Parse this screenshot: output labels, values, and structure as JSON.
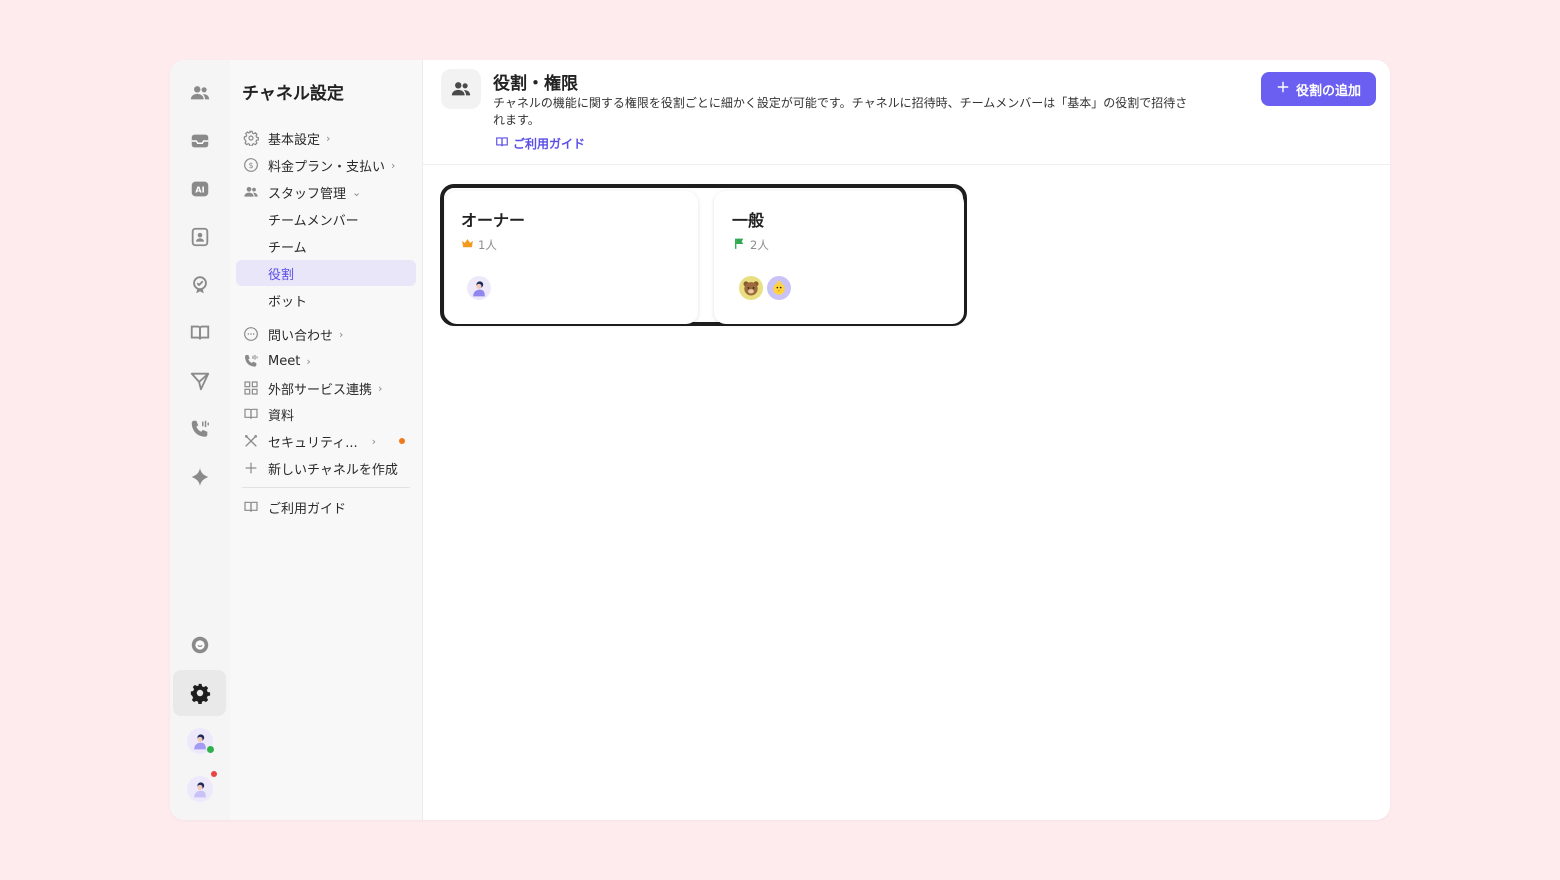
{
  "sidebar": {
    "title": "チャネル設定",
    "items": [
      {
        "label": "基本設定",
        "icon": "gear-icon"
      },
      {
        "label": "料金プラン・支払い",
        "icon": "dollar-icon"
      },
      {
        "label": "スタッフ管理",
        "icon": "people-icon"
      },
      {
        "label": "チームメンバー"
      },
      {
        "label": "チーム"
      },
      {
        "label": "役割"
      },
      {
        "label": "ボット"
      },
      {
        "label": "問い合わせ",
        "icon": "chat-icon"
      },
      {
        "label": "Meet",
        "icon": "phone-icon"
      },
      {
        "label": "外部サービス連携",
        "icon": "grid-icon"
      },
      {
        "label": "資料",
        "icon": "book-icon"
      },
      {
        "label": "セキュリティ...",
        "icon": "tools-icon"
      },
      {
        "label": "新しいチャネルを作成",
        "icon": "plus-icon"
      },
      {
        "label": "ご利用ガイド",
        "icon": "book-icon"
      }
    ]
  },
  "header": {
    "title": "役割・権限",
    "description": "チャネルの機能に関する権限を役割ごとに細かく設定が可能です。チャネルに招待時、チームメンバーは「基本」の役割で招待されます。",
    "guide_label": "ご利用ガイド",
    "add_button_label": "役割の追加"
  },
  "roles": [
    {
      "name": "オーナー",
      "count": "1人",
      "icon": "crown-icon"
    },
    {
      "name": "一般",
      "count": "2人",
      "icon": "flag-icon"
    }
  ],
  "colors": {
    "accent": "#6a5ff0",
    "background": "#fdebee",
    "status_online": "#2fb24c",
    "status_alert": "#e84545",
    "notice_dot": "#f07a1a"
  }
}
